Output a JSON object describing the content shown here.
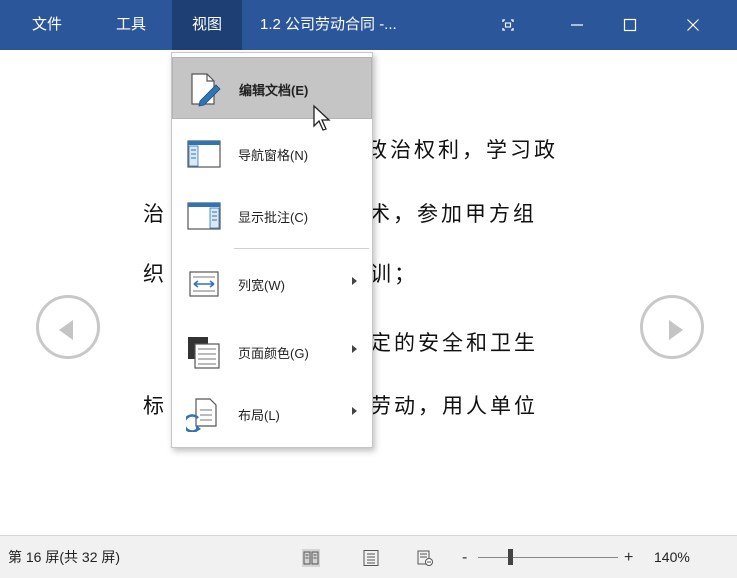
{
  "menubar": {
    "file": "文件",
    "tools": "工具",
    "view": "视图",
    "doc_title": "1.2  公司劳动合同  -..."
  },
  "document": {
    "line1": "政治权利，学习政",
    "line2a": "治",
    "line2b": "术，参加甲方组",
    "line3a": "织",
    "line3b": "训；",
    "line4": "定的安全和卫生",
    "line5a": "标",
    "line5b": "劳动，用人单位"
  },
  "view_menu": {
    "items": [
      {
        "label": "编辑文档(E)",
        "icon": "edit-document-icon"
      },
      {
        "label": "导航窗格(N)",
        "icon": "navigation-pane-icon"
      },
      {
        "label": "显示批注(C)",
        "icon": "show-comments-icon"
      },
      {
        "label": "列宽(W)",
        "icon": "column-width-icon"
      },
      {
        "label": "页面颜色(G)",
        "icon": "page-color-icon"
      },
      {
        "label": "布局(L)",
        "icon": "layout-icon"
      }
    ]
  },
  "statusbar": {
    "page_info": "第 16 屏(共 32 屏)",
    "zoom_minus": "-",
    "zoom_plus": "+",
    "zoom": "140%"
  },
  "colors": {
    "titlebar": "#2b579a",
    "active_menu": "#1e3f73",
    "menu_highlight": "#c5c5c5",
    "icon_blue": "#2e75b6"
  }
}
